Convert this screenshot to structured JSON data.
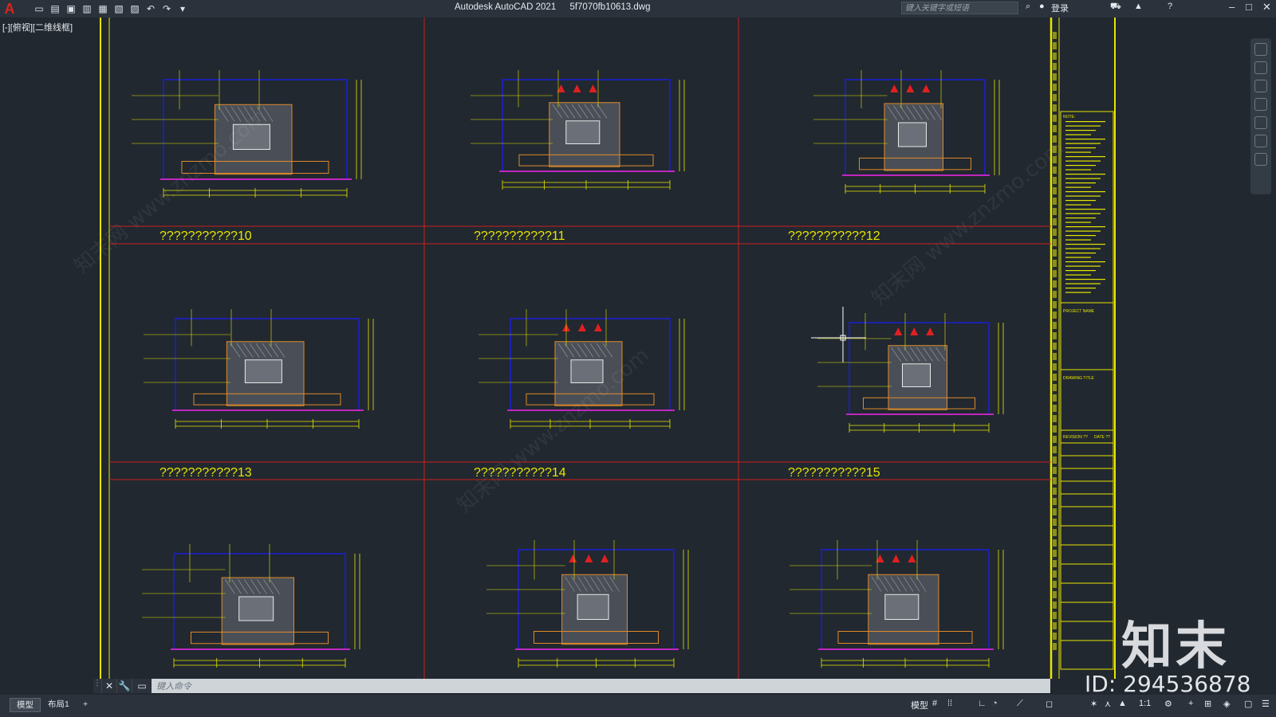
{
  "titlebar": {
    "app_name": "Autodesk AutoCAD 2021",
    "file_name": "5f7070fb10613.dwg",
    "search_placeholder": "键入关键字或短语",
    "signin_label": "登录"
  },
  "view_label": "[-][俯视][二维线框]",
  "drawing": {
    "panels": [
      {
        "title": "???????????10"
      },
      {
        "title": "???????????11"
      },
      {
        "title": "???????????12"
      },
      {
        "title": "???????????13"
      },
      {
        "title": "???????????14"
      },
      {
        "title": "???????????15"
      },
      {
        "title": ""
      },
      {
        "title": ""
      },
      {
        "title": ""
      }
    ],
    "notes_heading": "NOTE:",
    "project_name": "PROJECT NAME",
    "drawing_title": "DRAWING TITLE",
    "revision": "REVISION ??",
    "date": "DATE ??"
  },
  "command": {
    "placeholder": "键入命令"
  },
  "tabs": {
    "model": "模型",
    "layout1": "布局1",
    "add": "+"
  },
  "status": {
    "model_label": "模型",
    "scale": "1:1"
  },
  "watermark": {
    "brand": "知末",
    "id": "ID: 294536878",
    "site": "知末网 www.znzmo.com"
  },
  "colors": {
    "background": "#212830",
    "frame": "#e6e600",
    "divider": "#cc1f1f",
    "wall": "#1a1fd6",
    "furniture": "#e08a2a",
    "floor": "#c026c0"
  }
}
